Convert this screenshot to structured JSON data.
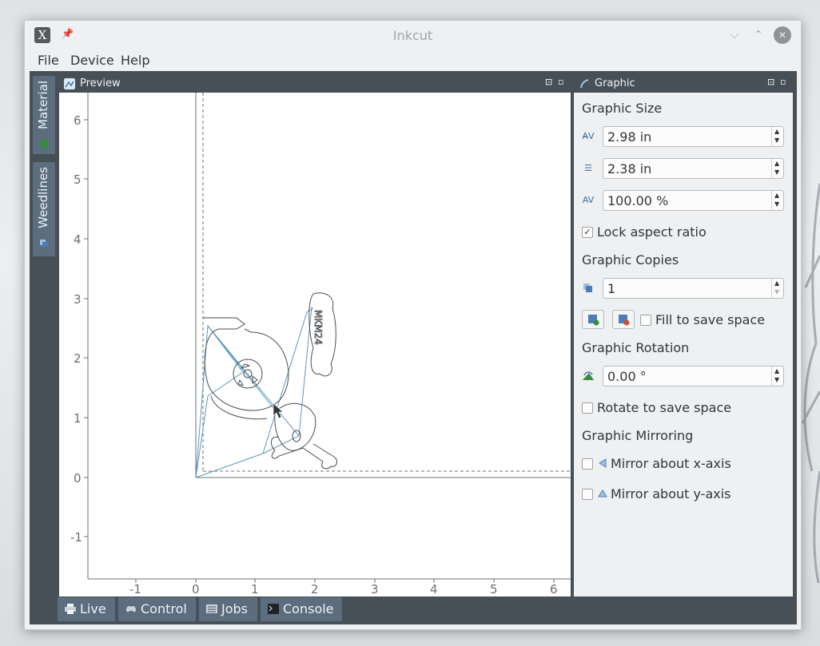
{
  "window": {
    "title": "Inkcut",
    "close_glyph": "✕",
    "minimize_glyph": "⌵",
    "maximize_glyph": "⌃"
  },
  "menu": {
    "items": [
      "File",
      "Device",
      "Help"
    ]
  },
  "side_tabs": [
    {
      "label": "Material",
      "icon": "material-icon"
    },
    {
      "label": "Weedlines",
      "icon": "weedlines-icon"
    }
  ],
  "preview": {
    "title": "Preview",
    "y_ticks": [
      "6",
      "5",
      "4",
      "3",
      "2",
      "1",
      "0",
      "-1"
    ],
    "x_ticks": [
      "-1",
      "0",
      "1",
      "2",
      "3",
      "4",
      "5",
      "6"
    ]
  },
  "graphic": {
    "title": "Graphic",
    "size_title": "Graphic Size",
    "width_value": "2.98 in",
    "height_value": "2.38 in",
    "scale_value": "100.00 %",
    "lock_aspect": {
      "label": "Lock aspect ratio",
      "checked": true,
      "mark": "✓"
    },
    "copies_title": "Graphic Copies",
    "copies_value": "1",
    "fill_to_save": {
      "label": "Fill to save space",
      "checked": false
    },
    "rotation_title": "Graphic Rotation",
    "rotation_value": "0.00 °",
    "rotate_to_save": {
      "label": "Rotate to save space",
      "checked": false
    },
    "mirroring_title": "Graphic Mirroring",
    "mirror_x": {
      "label": "Mirror about x-axis",
      "checked": false
    },
    "mirror_y": {
      "label": "Mirror about y-axis",
      "checked": false
    }
  },
  "bottom_tabs": [
    {
      "label": "Live",
      "icon": "printer-icon"
    },
    {
      "label": "Control",
      "icon": "gamepad-icon"
    },
    {
      "label": "Jobs",
      "icon": "list-icon"
    },
    {
      "label": "Console",
      "icon": "terminal-icon"
    }
  ]
}
